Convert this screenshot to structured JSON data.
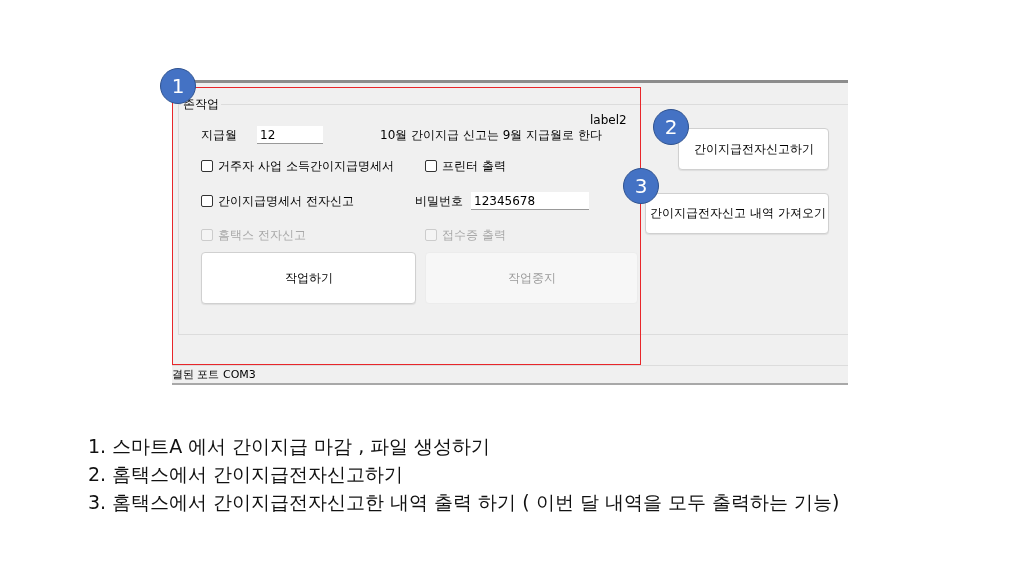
{
  "screenshot": {
    "group_title": "존작업",
    "month_label": "지급월",
    "month_value": "12",
    "notice": "10월 간이지급 신고는 9월 지급월로 한다",
    "label2": "label2",
    "checkboxes": [
      {
        "label": "거주자 사업 소득간이지급명세서",
        "checked": false,
        "disabled": false
      },
      {
        "label": "프린터 출력",
        "checked": false,
        "disabled": false
      },
      {
        "label": "간이지급명세서 전자신고",
        "checked": false,
        "disabled": false
      },
      {
        "label": "홈택스 전자신고",
        "checked": false,
        "disabled": true
      },
      {
        "label": "접수증 출력",
        "checked": false,
        "disabled": true
      }
    ],
    "password_label": "비밀번호",
    "password_value": "12345678",
    "buttons": [
      {
        "label": "작업하기",
        "disabled": false
      },
      {
        "label": "작업중지",
        "disabled": true
      }
    ],
    "side_buttons": [
      {
        "label": "간이지급전자신고하기"
      },
      {
        "label": "간이지급전자신고 내역 가져오기"
      }
    ],
    "status": "결된 포트 COM3"
  },
  "callouts": [
    {
      "number": "1"
    },
    {
      "number": "2"
    },
    {
      "number": "3"
    }
  ],
  "notes": [
    "1. 스마트A 에서 간이지급 마감 , 파일 생성하기",
    "2. 홈택스에서 간이지급전자신고하기",
    "3. 홈택스에서 간이지급전자신고한 내역 출력 하기 ( 이번 달 내역을 모두 출력하는 기능)"
  ]
}
